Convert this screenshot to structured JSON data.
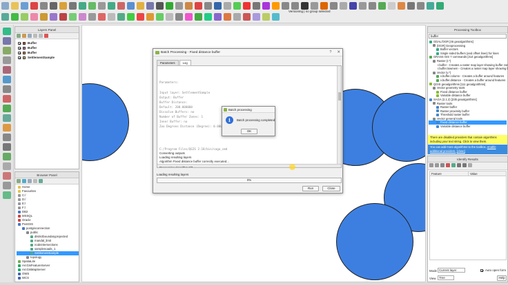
{
  "toolbar": {
    "status_text": "Versioning | no group selected",
    "row1_icons": [
      "#8aa9c9",
      "#e7c35a",
      "#6a9fd4",
      "#d44",
      "#888",
      "#666",
      "#d9a13a",
      "#777",
      "#4a8",
      "#6b6",
      "#999",
      "#4a8",
      "#c66",
      "#5a8fd0",
      "#e0b040",
      "#77a",
      "#555",
      "#3a3",
      "#999",
      "#c84",
      "#d44",
      "#888",
      "#36a",
      "#aaa",
      "#5c5",
      "#e33",
      "#777",
      "#a3d",
      "#f90",
      "#888",
      "#888",
      "#333",
      "#999",
      "#d60",
      "#888",
      "#aaa",
      "#44a",
      "#999",
      "#888",
      "#5a5",
      "#ccc",
      "#d84",
      "#777",
      "#888",
      "#4a9",
      "#3a7"
    ],
    "row2_icons": [
      "#5a9",
      "#4b4",
      "#9c6",
      "#e8a",
      "#c93",
      "#97c",
      "#b44",
      "#7c7",
      "#c8c",
      "#999",
      "#d66",
      "#bbb",
      "#5a8",
      "#4c4",
      "#e44",
      "#d93",
      "#6c6",
      "#bbb",
      "#888",
      "#e5c",
      "#4a4",
      "#2c8",
      "#86c",
      "#d74",
      "#aaa",
      "#c55",
      "#a9d",
      "#bc6",
      "#5bc"
    ]
  },
  "left_tools": [
    "#3b8",
    "#77a",
    "#8a6",
    "#999",
    "#a67",
    "#59c",
    "#888",
    "#c66",
    "#5a5",
    "#6a9",
    "#d94",
    "#888",
    "#777",
    "#6a6",
    "#aaa",
    "#c77",
    "#999",
    "#6b8"
  ],
  "layers_panel": {
    "title": "Layers Panel",
    "layers": [
      {
        "name": "Buffer",
        "color": "#d34848"
      },
      {
        "name": "Buffer",
        "color": "#d96ec4"
      },
      {
        "name": "Buffer",
        "color": "#e67e2b"
      },
      {
        "name": "SettlementSample",
        "color": "#c8c84a"
      }
    ]
  },
  "browser_panel": {
    "title": "Browser Panel",
    "items": [
      {
        "label": "Home",
        "indent": 0,
        "color": "#e8c24a"
      },
      {
        "label": "Favourites",
        "indent": 0,
        "color": "#e8c24a"
      },
      {
        "label": "C:/",
        "indent": 0,
        "color": "#999"
      },
      {
        "label": "D:/",
        "indent": 0,
        "color": "#999"
      },
      {
        "label": "E:/",
        "indent": 0,
        "color": "#999"
      },
      {
        "label": "F:/",
        "indent": 0,
        "color": "#999"
      },
      {
        "label": "DB2",
        "indent": 0,
        "color": "#4a76c4"
      },
      {
        "label": "MSSQL",
        "indent": 0,
        "color": "#c44"
      },
      {
        "label": "Oracle",
        "indent": 0,
        "color": "#c44"
      },
      {
        "label": "PostGIS",
        "indent": 0,
        "color": "#4a76c4"
      },
      {
        "label": "postgisconnection",
        "indent": 1,
        "color": "#4a76c4"
      },
      {
        "label": "public",
        "indent": 2,
        "color": "#888"
      },
      {
        "label": "districtboundaryprojected",
        "indent": 3,
        "color": "#5a8"
      },
      {
        "label": "mandal_limit",
        "indent": 3,
        "color": "#5a8"
      },
      {
        "label": "nodeintersections",
        "indent": 3,
        "color": "#5a8"
      },
      {
        "label": "samplenoads_1",
        "indent": 3,
        "color": "#5a8"
      },
      {
        "label": "SettlementSample",
        "indent": 3,
        "color": "#5a8",
        "selected": true
      },
      {
        "label": "topology",
        "indent": 2,
        "color": "#888"
      },
      {
        "label": "SpatiaLite",
        "indent": 0,
        "color": "#7a5"
      },
      {
        "label": "ArcGisFeatureServer",
        "indent": 0,
        "color": "#2a6"
      },
      {
        "label": "ArcGisMapServer",
        "indent": 0,
        "color": "#2a6"
      },
      {
        "label": "OWS",
        "indent": 0,
        "color": "#46a"
      },
      {
        "label": "WCS",
        "indent": 0,
        "color": "#46a"
      }
    ]
  },
  "batch_dialog": {
    "title": "Batch Processing - Fixed distance buffer",
    "tabs": [
      {
        "label": "Parameters"
      },
      {
        "label": "Log",
        "active": true
      }
    ],
    "log_lines": [
      {
        "text": "Parameters:",
        "mono": true
      },
      {
        "text": "Input layer: SettlementSample",
        "mono": true
      },
      {
        "text": "Output: Buffer",
        "mono": true
      },
      {
        "text": "Buffer Distance:",
        "mono": true
      },
      {
        "text": "Default: 200.000000",
        "mono": true
      },
      {
        "text": "Dissolve Buffers: no",
        "mono": true
      },
      {
        "text": "Number of Buffer Zones: 1",
        "mono": true
      },
      {
        "text": "Inner Buffer: no",
        "mono": true
      },
      {
        "text": "Zoo Degrees Distance (Degree): 0.0000",
        "mono": true
      },
      {
        "text": "C:/Program Files/QGIS 2.18/bin/saga_cmd",
        "mono": true
      },
      {
        "text": "Converting outputs",
        "mono": false
      },
      {
        "text": "Loading resulting layers",
        "mono": false
      },
      {
        "text": "Algorithm Fixed distance buffer correctly executed...",
        "mono": false
      },
      {
        "text": "Processing algorithm 2/3...",
        "mono": false
      }
    ],
    "status": "Loading resulting layers",
    "progress_percent": 0,
    "progress_text": "0%",
    "run_label": "Run",
    "close_label": "Close",
    "help_glyph": "?",
    "close_glyph": "✕"
  },
  "message_box": {
    "title": "Batch processing",
    "message": "Batch processing completed",
    "ok_label": "OK"
  },
  "toolbox": {
    "title": "Processing Toolbox",
    "search_value": "buffer",
    "items": [
      {
        "text": "GDAL/OGR [46 geoalgorithms]",
        "indent": 0,
        "color": "#3a8"
      },
      {
        "text": "[OGR] Geoprocessing",
        "indent": 1,
        "color": "#888"
      },
      {
        "text": "Buffer vectors",
        "indent": 2,
        "color": "#3a8"
      },
      {
        "text": "Single sided buffers (and offset lines) for lines",
        "indent": 2,
        "color": "#3a8"
      },
      {
        "text": "GRASS GIS 7 commands [314 geoalgorithms]",
        "indent": 0,
        "color": "#5a5"
      },
      {
        "text": "Raster (r.*)",
        "indent": 1,
        "color": "#888"
      },
      {
        "text": "r.buffer - Creates a raster map layer showing buffer zones",
        "indent": 2,
        "color": "#5a5"
      },
      {
        "text": "r.buffer.lowmem - Creates a raster map layer showing buffer",
        "indent": 2,
        "color": "#5a5"
      },
      {
        "text": "Vector (v.*)",
        "indent": 1,
        "color": "#888"
      },
      {
        "text": "v.buffer.column - Creates a buffer around features",
        "indent": 2,
        "color": "#5a5"
      },
      {
        "text": "v.buffer.distance - Creates a buffer around features",
        "indent": 2,
        "color": "#5a5"
      },
      {
        "text": "QGIS geoalgorithms [111 geoalgorithms]",
        "indent": 0,
        "color": "#8b3"
      },
      {
        "text": "Vector geometry tools",
        "indent": 1,
        "color": "#888"
      },
      {
        "text": "Fixed distance buffer",
        "indent": 2,
        "color": "#8b3"
      },
      {
        "text": "Variable distance buffer",
        "indent": 2,
        "color": "#8b3"
      },
      {
        "text": "SAGA (2.1.2) [235 geoalgorithms]",
        "indent": 0,
        "color": "#48c"
      },
      {
        "text": "Raster tools",
        "indent": 1,
        "color": "#888"
      },
      {
        "text": "Raster buffer",
        "indent": 2,
        "color": "#48c"
      },
      {
        "text": "Raster proximity buffer",
        "indent": 2,
        "color": "#48c"
      },
      {
        "text": "Threshold raster buffer",
        "indent": 2,
        "color": "#48c"
      },
      {
        "text": "Vector general tools",
        "indent": 1,
        "color": "#888"
      },
      {
        "text": "Fixed distance buffer",
        "indent": 2,
        "color": "#48c",
        "selected": true
      },
      {
        "text": "Variable distance buffer",
        "indent": 2,
        "color": "#48c"
      }
    ],
    "notice_yellow": "There are disabled providers that contain algorithms including your text string. Click to view them.",
    "notice_blue_1": "You can add more algorithms to the toolbox,",
    "notice_blue_link": "enable additional providers.",
    "notice_blue_close": "[close]"
  },
  "identify": {
    "title": "Identify Results",
    "col_feature": "Feature",
    "col_value": "Value",
    "mode_label": "Mode",
    "mode_value": "Current layer",
    "auto_open_label": "Auto open form",
    "view_label": "View",
    "view_value": "Tree",
    "help_label": "Help"
  },
  "colors": {
    "buffer_fill": "#3d7fe0",
    "selection": "#3399ff",
    "yellow_notice": "#ffff66",
    "blue_notice": "#3c8cde"
  }
}
